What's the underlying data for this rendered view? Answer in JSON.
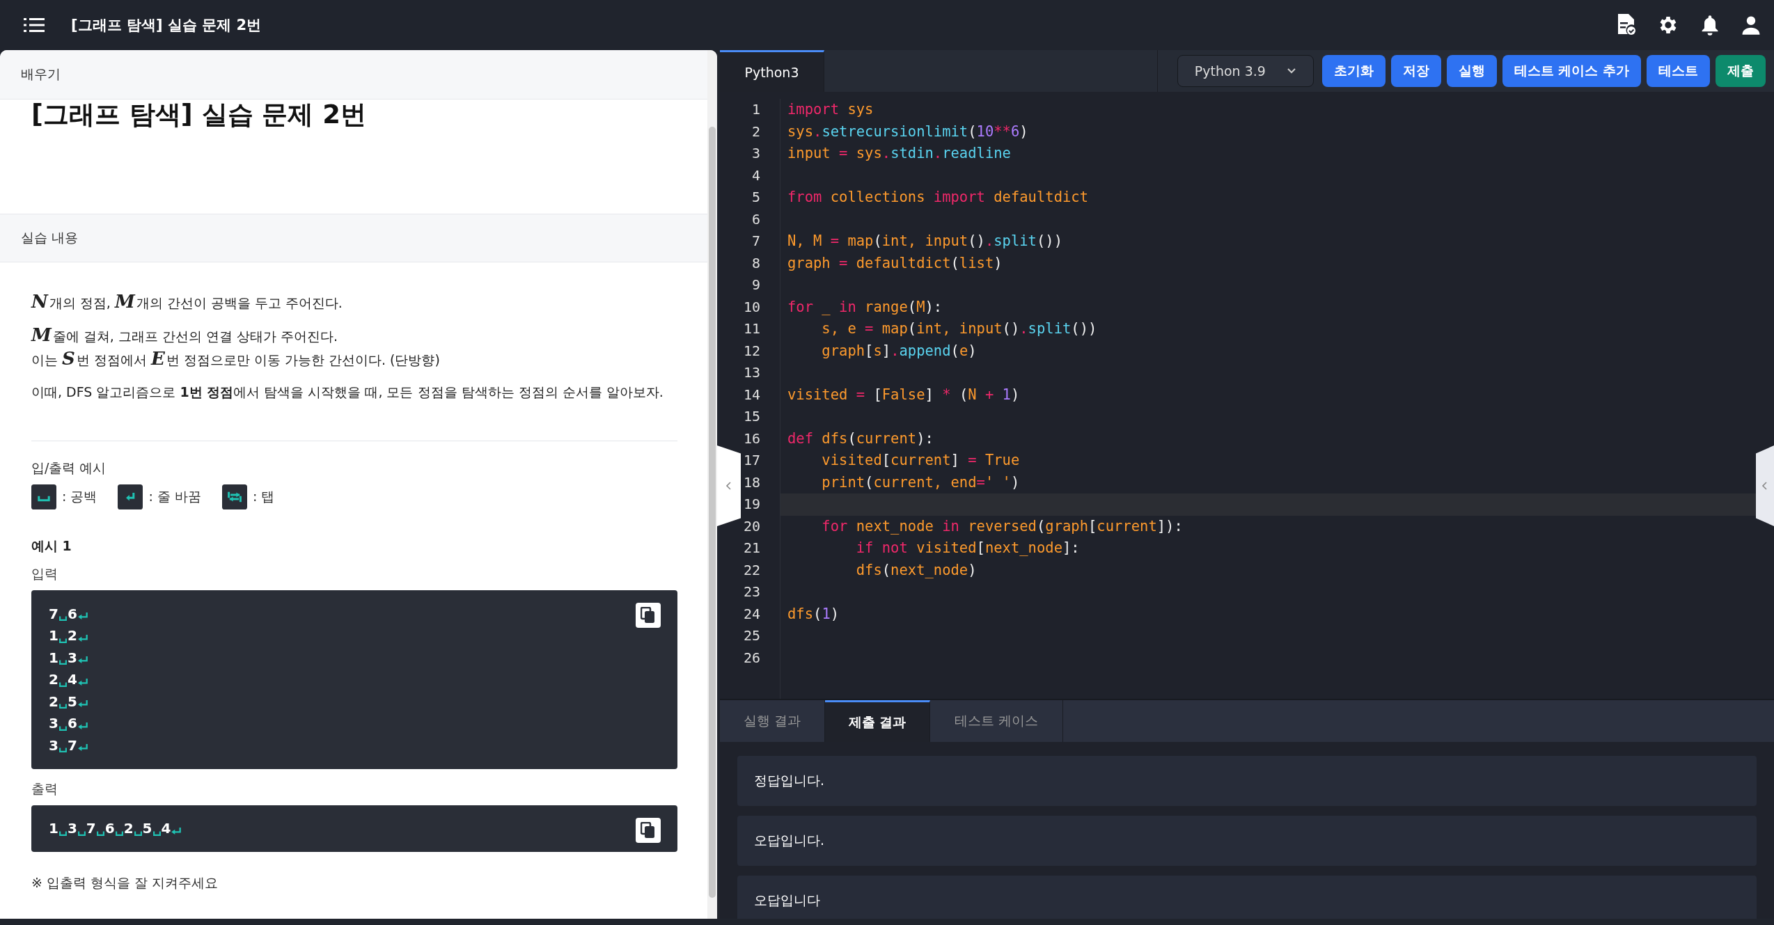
{
  "topbar": {
    "title": "[그래프 탐색] 실습 문제 2번"
  },
  "problem": {
    "section_label": "배우기",
    "title": "[그래프 탐색] 실습 문제 2번",
    "content_label": "실습 내용",
    "paragraphs": [
      {
        "lines": [
          [
            {
              "kind": "math",
              "text": "N"
            },
            {
              "kind": "text",
              "text": "개의 정점, "
            },
            {
              "kind": "math",
              "text": "M"
            },
            {
              "kind": "text",
              "text": "개의 간선이 공백을 두고 주어진다."
            }
          ]
        ]
      },
      {
        "lines": [
          [
            {
              "kind": "math",
              "text": "M"
            },
            {
              "kind": "text",
              "text": "줄에 걸쳐, 그래프 간선의 연결 상태가 주어진다."
            }
          ],
          [
            {
              "kind": "text",
              "text": "이는 "
            },
            {
              "kind": "math",
              "text": "S"
            },
            {
              "kind": "text",
              "text": "번 정점에서 "
            },
            {
              "kind": "math",
              "text": "E"
            },
            {
              "kind": "text",
              "text": "번 정점으로만 이동 가능한 간선이다. (단방향)"
            }
          ]
        ]
      },
      {
        "lines": [
          [
            {
              "kind": "text",
              "text": "이때, DFS 알고리즘으로 **1번 정점**에서 탐색을 시작했을 때, 모든 정점을 탐색하는 정점의 순서를 알아보자."
            }
          ]
        ]
      }
    ],
    "io_heading": "입/출력 예시",
    "legend": [
      {
        "kind": "space",
        "label": ": 공백"
      },
      {
        "kind": "newline",
        "label": ": 줄 바꿈"
      },
      {
        "kind": "tab",
        "label": ": 탭"
      }
    ],
    "example_title": "예시 1",
    "input_label": "입력",
    "input_lines": [
      [
        "7",
        "6"
      ],
      [
        "1",
        "2"
      ],
      [
        "1",
        "3"
      ],
      [
        "2",
        "4"
      ],
      [
        "2",
        "5"
      ],
      [
        "3",
        "6"
      ],
      [
        "3",
        "7"
      ]
    ],
    "output_label": "출력",
    "output_lines": [
      [
        "1",
        "3",
        "7",
        "6",
        "2",
        "5",
        "4"
      ]
    ],
    "note": "※ 입출력 형식을 잘 지켜주세요"
  },
  "editor": {
    "tabs": [
      {
        "label": "Python3",
        "selected": true
      }
    ],
    "version": "Python 3.9",
    "buttons": [
      {
        "label": "초기화",
        "kind": "primary"
      },
      {
        "label": "저장",
        "kind": "primary"
      },
      {
        "label": "실행",
        "kind": "primary"
      },
      {
        "label": "테스트 케이스 추가",
        "kind": "primary"
      },
      {
        "label": "테스트",
        "kind": "primary"
      },
      {
        "label": "제출",
        "kind": "submit"
      }
    ],
    "code": [
      {
        "number": "1",
        "highlighted": false,
        "tokens": [
          {
            "kind": "keyword",
            "text": "import "
          },
          {
            "kind": "name",
            "text": "sys"
          }
        ]
      },
      {
        "number": "2",
        "highlighted": false,
        "tokens": [
          {
            "kind": "name",
            "text": "sys"
          },
          {
            "kind": "keyword",
            "text": "."
          },
          {
            "kind": "method",
            "text": "setrecursionlimit"
          },
          {
            "kind": "punct",
            "text": "("
          },
          {
            "kind": "number",
            "text": "10"
          },
          {
            "kind": "keyword",
            "text": "**"
          },
          {
            "kind": "number",
            "text": "6"
          },
          {
            "kind": "punct",
            "text": ")"
          }
        ]
      },
      {
        "number": "3",
        "highlighted": false,
        "tokens": [
          {
            "kind": "name",
            "text": "input"
          },
          {
            "kind": "keyword",
            "text": " = "
          },
          {
            "kind": "name",
            "text": "sys"
          },
          {
            "kind": "keyword",
            "text": "."
          },
          {
            "kind": "method",
            "text": "stdin"
          },
          {
            "kind": "keyword",
            "text": "."
          },
          {
            "kind": "method",
            "text": "readline"
          }
        ]
      },
      {
        "number": "4",
        "highlighted": false
      },
      {
        "number": "5",
        "highlighted": false,
        "tokens": [
          {
            "kind": "keyword",
            "text": "from "
          },
          {
            "kind": "name",
            "text": "collections "
          },
          {
            "kind": "keyword",
            "text": "import "
          },
          {
            "kind": "name",
            "text": "defaultdict"
          }
        ]
      },
      {
        "number": "6",
        "highlighted": false
      },
      {
        "number": "7",
        "highlighted": false,
        "tokens": [
          {
            "kind": "name",
            "text": "N, M"
          },
          {
            "kind": "keyword",
            "text": " = "
          },
          {
            "kind": "name",
            "text": "map"
          },
          {
            "kind": "punct",
            "text": "("
          },
          {
            "kind": "name",
            "text": "int, input"
          },
          {
            "kind": "punct",
            "text": "()"
          },
          {
            "kind": "keyword",
            "text": "."
          },
          {
            "kind": "method",
            "text": "split"
          },
          {
            "kind": "punct",
            "text": "())"
          }
        ]
      },
      {
        "number": "8",
        "highlighted": false,
        "tokens": [
          {
            "kind": "name",
            "text": "graph"
          },
          {
            "kind": "keyword",
            "text": " = "
          },
          {
            "kind": "name",
            "text": "defaultdict"
          },
          {
            "kind": "punct",
            "text": "("
          },
          {
            "kind": "name",
            "text": "list"
          },
          {
            "kind": "punct",
            "text": ")"
          }
        ]
      },
      {
        "number": "9",
        "highlighted": false
      },
      {
        "number": "10",
        "highlighted": false,
        "tokens": [
          {
            "kind": "keyword",
            "text": "for"
          },
          {
            "kind": "name",
            "text": " _ "
          },
          {
            "kind": "keyword",
            "text": "in"
          },
          {
            "kind": "name",
            "text": " range"
          },
          {
            "kind": "punct",
            "text": "("
          },
          {
            "kind": "name",
            "text": "M"
          },
          {
            "kind": "punct",
            "text": "):"
          }
        ]
      },
      {
        "number": "11",
        "highlighted": false,
        "tokens": [
          {
            "kind": "name",
            "text": "    s, e"
          },
          {
            "kind": "keyword",
            "text": " = "
          },
          {
            "kind": "name",
            "text": "map"
          },
          {
            "kind": "punct",
            "text": "("
          },
          {
            "kind": "name",
            "text": "int, input"
          },
          {
            "kind": "punct",
            "text": "()"
          },
          {
            "kind": "keyword",
            "text": "."
          },
          {
            "kind": "method",
            "text": "split"
          },
          {
            "kind": "punct",
            "text": "())"
          }
        ]
      },
      {
        "number": "12",
        "highlighted": false,
        "tokens": [
          {
            "kind": "name",
            "text": "    graph"
          },
          {
            "kind": "punct",
            "text": "["
          },
          {
            "kind": "name",
            "text": "s"
          },
          {
            "kind": "punct",
            "text": "]"
          },
          {
            "kind": "keyword",
            "text": "."
          },
          {
            "kind": "method",
            "text": "append"
          },
          {
            "kind": "punct",
            "text": "("
          },
          {
            "kind": "name",
            "text": "e"
          },
          {
            "kind": "punct",
            "text": ")"
          }
        ]
      },
      {
        "number": "13",
        "highlighted": false
      },
      {
        "number": "14",
        "highlighted": false,
        "tokens": [
          {
            "kind": "name",
            "text": "visited"
          },
          {
            "kind": "keyword",
            "text": " = "
          },
          {
            "kind": "punct",
            "text": "["
          },
          {
            "kind": "name",
            "text": "False"
          },
          {
            "kind": "punct",
            "text": "]"
          },
          {
            "kind": "keyword",
            "text": " * "
          },
          {
            "kind": "punct",
            "text": "("
          },
          {
            "kind": "name",
            "text": "N "
          },
          {
            "kind": "keyword",
            "text": "+ "
          },
          {
            "kind": "number",
            "text": "1"
          },
          {
            "kind": "punct",
            "text": ")"
          }
        ]
      },
      {
        "number": "15",
        "highlighted": false
      },
      {
        "number": "16",
        "highlighted": false,
        "tokens": [
          {
            "kind": "keyword",
            "text": "def"
          },
          {
            "kind": "name",
            "text": " dfs"
          },
          {
            "kind": "punct",
            "text": "("
          },
          {
            "kind": "name",
            "text": "current"
          },
          {
            "kind": "punct",
            "text": "):"
          }
        ]
      },
      {
        "number": "17",
        "highlighted": false,
        "tokens": [
          {
            "kind": "name",
            "text": "    visited"
          },
          {
            "kind": "punct",
            "text": "["
          },
          {
            "kind": "name",
            "text": "current"
          },
          {
            "kind": "punct",
            "text": "]"
          },
          {
            "kind": "keyword",
            "text": " = "
          },
          {
            "kind": "name",
            "text": "True"
          }
        ]
      },
      {
        "number": "18",
        "highlighted": false,
        "tokens": [
          {
            "kind": "name",
            "text": "    print"
          },
          {
            "kind": "punct",
            "text": "("
          },
          {
            "kind": "name",
            "text": "current, end"
          },
          {
            "kind": "keyword",
            "text": "="
          },
          {
            "kind": "name",
            "text": "' '"
          },
          {
            "kind": "punct",
            "text": ")"
          }
        ]
      },
      {
        "number": "19",
        "highlighted": true
      },
      {
        "number": "20",
        "highlighted": false,
        "tokens": [
          {
            "kind": "keyword",
            "text": "    for"
          },
          {
            "kind": "name",
            "text": " next_node "
          },
          {
            "kind": "keyword",
            "text": "in"
          },
          {
            "kind": "name",
            "text": " reversed"
          },
          {
            "kind": "punct",
            "text": "("
          },
          {
            "kind": "name",
            "text": "graph"
          },
          {
            "kind": "punct",
            "text": "["
          },
          {
            "kind": "name",
            "text": "current"
          },
          {
            "kind": "punct",
            "text": "]):"
          }
        ]
      },
      {
        "number": "21",
        "highlighted": false,
        "tokens": [
          {
            "kind": "keyword",
            "text": "        if not"
          },
          {
            "kind": "name",
            "text": " visited"
          },
          {
            "kind": "punct",
            "text": "["
          },
          {
            "kind": "name",
            "text": "next_node"
          },
          {
            "kind": "punct",
            "text": "]:"
          }
        ]
      },
      {
        "number": "22",
        "highlighted": false,
        "tokens": [
          {
            "kind": "name",
            "text": "        dfs"
          },
          {
            "kind": "punct",
            "text": "("
          },
          {
            "kind": "name",
            "text": "next_node"
          },
          {
            "kind": "punct",
            "text": ")"
          }
        ]
      },
      {
        "number": "23",
        "highlighted": false
      },
      {
        "number": "24",
        "highlighted": false,
        "tokens": [
          {
            "kind": "name",
            "text": "dfs"
          },
          {
            "kind": "punct",
            "text": "("
          },
          {
            "kind": "number",
            "text": "1"
          },
          {
            "kind": "punct",
            "text": ")"
          }
        ]
      },
      {
        "number": "25",
        "highlighted": false
      },
      {
        "number": "26",
        "highlighted": false
      }
    ]
  },
  "results": {
    "tabs": [
      {
        "label": "실행 결과",
        "selected": false
      },
      {
        "label": "제출 결과",
        "selected": true
      },
      {
        "label": "테스트 케이스",
        "selected": false
      }
    ],
    "items": [
      "정답입니다.",
      "오답입니다.",
      "오답입니다"
    ]
  }
}
